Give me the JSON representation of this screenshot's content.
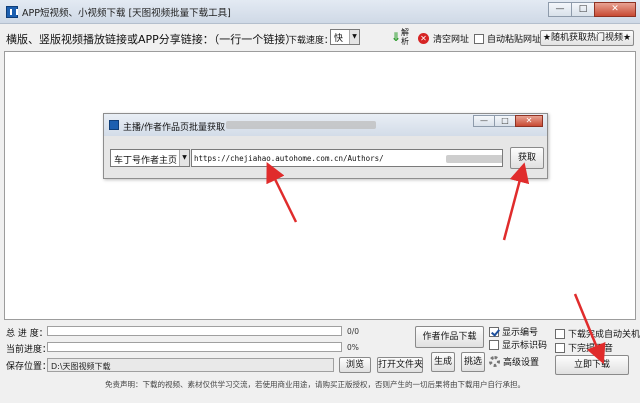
{
  "window": {
    "title": "APP短视频、小视频下载 [天图视频批量下载工具]",
    "minimize_label": "—",
    "maximize_label": "□",
    "close_label": "✕"
  },
  "toolbar": {
    "prompt": "横版、竖版视频播放链接或APP分享链接：（一行一个链接）",
    "speed_label": "下载速度：",
    "speed_value": "快",
    "parse_label": "解析",
    "clear_label": "清空网址",
    "autopaste_label": "自动粘贴网址",
    "hot_videos_label": "★随机获取热门视频★"
  },
  "dialog": {
    "title": "主播/作者作品页批量获取",
    "minimize_label": "—",
    "maximize_label": "□",
    "close_label": "✕",
    "source_value": "车丁号作者主页",
    "url_value": "https://chejiahao.autohome.com.cn/Authors/",
    "fetch_label": "获取"
  },
  "progress": {
    "total_label": "总 进 度：",
    "total_text": "0/0",
    "total_fraction": 0,
    "current_label": "当前进度：",
    "current_text": "0%",
    "current_fraction": 0
  },
  "save": {
    "label": "保存位置：",
    "path": "D:\\天图视频下载",
    "browse_label": "浏览",
    "open_folder_label": "打开文件夹"
  },
  "actions": {
    "author_works_label": "作者作品下载",
    "generate_label": "生成",
    "pick_label": "挑选",
    "show_number_label": "显示编号",
    "show_number_checked": true,
    "show_watermark_label": "显示标识码",
    "show_watermark_checked": false,
    "advanced_label": "高级设置",
    "shutdown_label": "下载完成自动关机",
    "sound_label": "下完提示音",
    "download_label": "立即下载"
  },
  "disclaimer": "免责声明：下载的视频、素材仅供学习交流，若使用商业用途，请购买正版授权，否则产生的一切后果将由下载用户自行承担。",
  "colors": {
    "annotation_red": "#e02c2c",
    "progress_green": "#3c9a3c",
    "title_blue": "#1c5fb0"
  }
}
